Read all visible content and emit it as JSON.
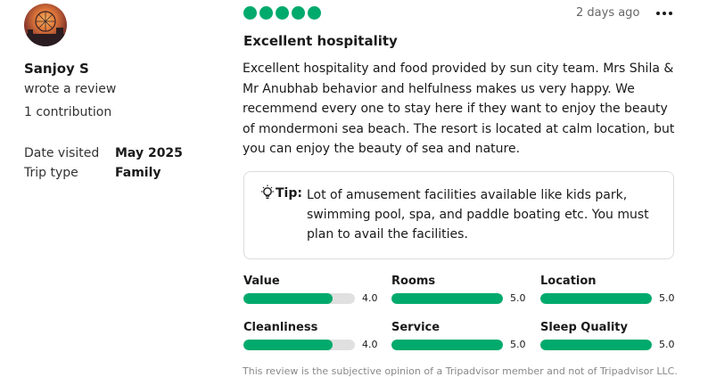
{
  "reviewer": {
    "name": "Sanjoy S",
    "action": "wrote a review",
    "contributions": "1 contribution"
  },
  "meta": {
    "date_visited_label": "Date visited",
    "date_visited_value": "May 2025",
    "trip_type_label": "Trip type",
    "trip_type_value": "Family"
  },
  "review": {
    "bubble_rating": 5,
    "bubble_max": 5,
    "posted": "2 days ago",
    "title": "Excellent hospitality",
    "text": "Excellent hospitality and food provided by sun city team. Mrs Shila & Mr Anubhab behavior and helfulness makes us very happy. We recemmend every one to stay here if they want to enjoy the beauty of mondermoni sea beach. The resort is located at calm location, but you can enjoy the beauty of sea and nature.",
    "tip_label": "Tip:",
    "tip_text": "Lot of amusement facilities available like kids park, swimming pool, spa, and paddle boating etc. You must plan to avail the facilities.",
    "ratings": [
      {
        "label": "Value",
        "score": "4.0",
        "fraction": 0.8
      },
      {
        "label": "Rooms",
        "score": "5.0",
        "fraction": 1.0
      },
      {
        "label": "Location",
        "score": "5.0",
        "fraction": 1.0
      },
      {
        "label": "Cleanliness",
        "score": "4.0",
        "fraction": 0.8
      },
      {
        "label": "Service",
        "score": "5.0",
        "fraction": 1.0
      },
      {
        "label": "Sleep Quality",
        "score": "5.0",
        "fraction": 1.0
      }
    ],
    "disclaimer": "This review is the subjective opinion of a Tripadvisor member and not of Tripadvisor LLC."
  },
  "colors": {
    "accent": "#00aa6c",
    "track": "#e0e0e0"
  },
  "icons": {
    "more": "more-options-icon",
    "tip": "lightbulb-icon"
  }
}
